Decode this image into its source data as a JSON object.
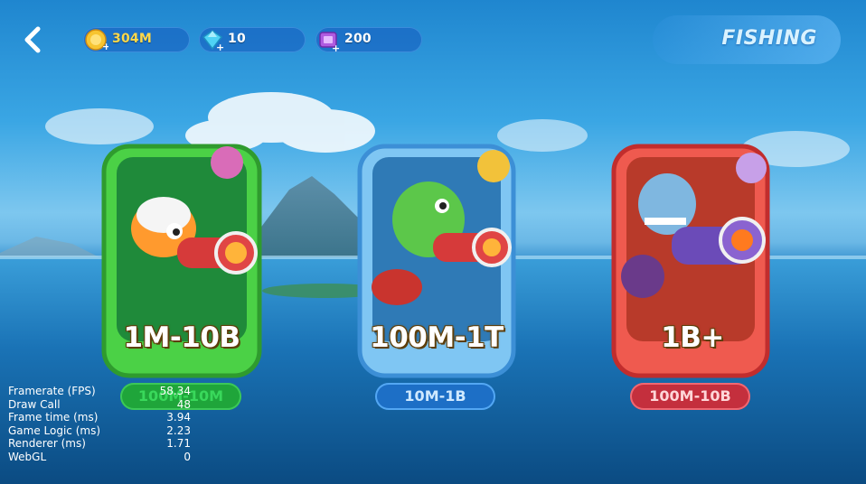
{
  "header": {
    "title": "FISHING",
    "gold": "304M",
    "gems": "10",
    "tickets": "200",
    "icons": [
      "back-arrow-icon",
      "gold-coin-plus-icon",
      "gem-plus-icon",
      "ticket-plus-icon"
    ]
  },
  "rooms": [
    {
      "range": "1M-10B",
      "bet": "100M-10M",
      "theme": "green",
      "color": "#49c63d"
    },
    {
      "range": "100M-1T",
      "bet": "10M-1B",
      "theme": "blue",
      "color": "#4fa6e6"
    },
    {
      "range": "1B+",
      "bet": "100M-10B",
      "theme": "red",
      "color": "#e3423f"
    }
  ],
  "stats": [
    {
      "label": "Framerate (FPS)",
      "value": "58.34"
    },
    {
      "label": "Draw Call",
      "value": "48"
    },
    {
      "label": "Frame time (ms)",
      "value": "3.94"
    },
    {
      "label": "Game Logic (ms)",
      "value": "2.23"
    },
    {
      "label": "Renderer (ms)",
      "value": "1.71"
    },
    {
      "label": "WebGL",
      "value": "0"
    }
  ]
}
